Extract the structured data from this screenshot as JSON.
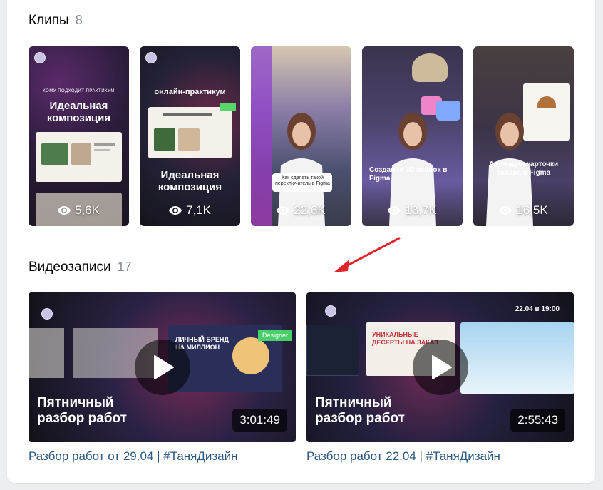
{
  "clips_section": {
    "title": "Клипы",
    "count": "8",
    "items": [
      {
        "views": "5,6K",
        "tagline": "КОМУ ПОДХОДИТ ПРАКТИКУМ",
        "heading": "Идеальная композиция",
        "bg": "#2a1c3a"
      },
      {
        "views": "7,1K",
        "tagline": "онлайн-практикум",
        "heading": "Идеальная композиция",
        "bg": "#222233"
      },
      {
        "views": "22,6K",
        "caption": "Как сделать такой переключатель в Figma",
        "bg": "#5a4a8a"
      },
      {
        "views": "13,7K",
        "caption": "Создание 3D иконок в Figma",
        "bg": "#4a3c6e"
      },
      {
        "views": "16,5K",
        "caption": "Анимация карточки товара в Figma",
        "bg": "#3c3446"
      }
    ]
  },
  "videos_section": {
    "title": "Видеозаписи",
    "count": "17",
    "items": [
      {
        "duration": "3:01:49",
        "thumb_title": "Пятничный разбор работ",
        "caption": "Разбор работ от 29.04 | #ТаняДизайн",
        "badge": "Designer",
        "promo": "ЛИЧНЫЙ БРЕНД НА МИЛЛИОН"
      },
      {
        "duration": "2:55:43",
        "thumb_title": "Пятничный разбор работ",
        "caption": "Разбор работ 22.04 | #ТаняДизайн",
        "date_badge": "22.04 в 19:00",
        "promo": "УНИКАЛЬНЫЕ ДЕСЕРТЫ НА ЗАКАЗ"
      }
    ]
  },
  "colors": {
    "link": "#2a5885",
    "muted": "#818c99",
    "annotation_arrow": "#e0242a"
  }
}
